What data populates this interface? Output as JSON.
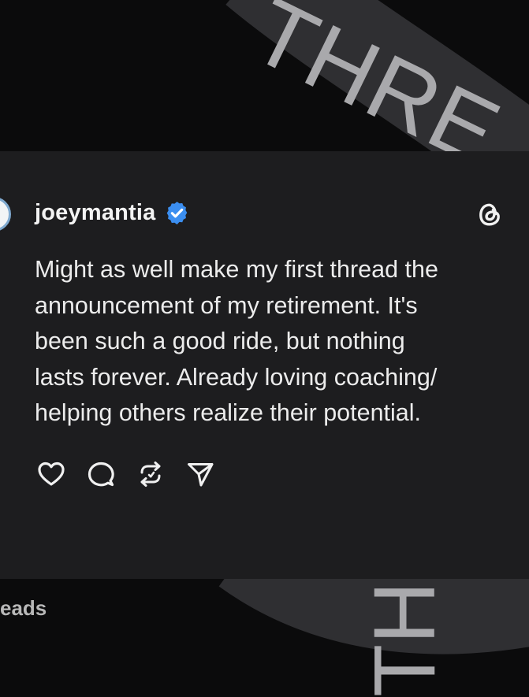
{
  "post": {
    "username": "joeymantia",
    "verified": true,
    "text": "Might as well make my first thread the\nannouncement of my retirement. It's\nbeen such a good ride, but nothing\nlasts forever. Already loving coaching/\nhelping others realize their potential."
  },
  "actions": [
    {
      "name": "like",
      "icon": "heart-icon"
    },
    {
      "name": "reply",
      "icon": "comment-icon"
    },
    {
      "name": "repost",
      "icon": "repost-icon"
    },
    {
      "name": "share",
      "icon": "send-icon"
    }
  ],
  "background": {
    "top_ribbon_text": "THRE",
    "bottom_ribbon_text": "TH"
  },
  "footer": {
    "text": "eads"
  },
  "colors": {
    "page_background": "#0b0b0c",
    "card_background": "#1d1d1f",
    "ribbon": "#2f2f32",
    "ribbon_text": "#a9a9ac",
    "verified_badge": "#3b8ef0",
    "text": "#ececec"
  }
}
